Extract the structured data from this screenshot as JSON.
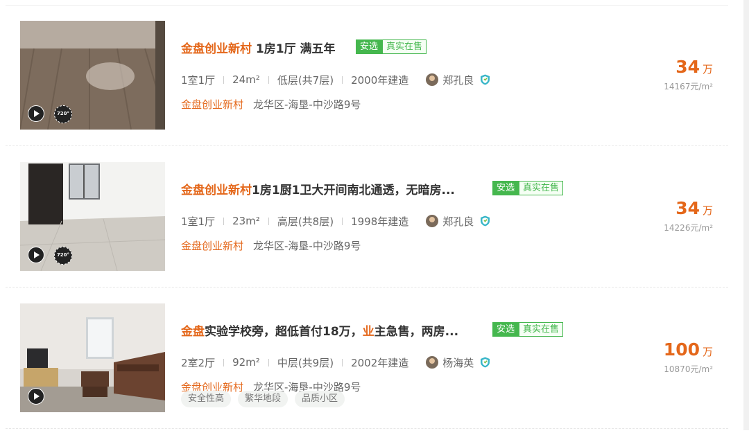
{
  "listings": [
    {
      "title_prefix": "金盘创业新村",
      "title_rest": " 1房1厅 满五年",
      "badge_selected": "安选",
      "badge_real": "真实在售",
      "layout": "1室1厅",
      "area": "24m²",
      "floor": "低层(共7层)",
      "built": "2000年建造",
      "agent": "郑孔良",
      "community": "金盘创业新村",
      "district": "龙华区-海垦-中沙路9号",
      "price": "34",
      "price_unit": "万",
      "unit_price": "14167元/m²",
      "icons": [
        "play-icon",
        "vr-720-icon",
        "verified-shield-icon"
      ]
    },
    {
      "title_prefix": "金盘创业新村",
      "title_rest": "1房1厨1卫大开间南北通透，无暗房...",
      "badge_selected": "安选",
      "badge_real": "真实在售",
      "layout": "1室1厅",
      "area": "23m²",
      "floor": "高层(共8层)",
      "built": "1998年建造",
      "agent": "郑孔良",
      "community": "金盘创业新村",
      "district": "龙华区-海垦-中沙路9号",
      "price": "34",
      "price_unit": "万",
      "unit_price": "14226元/m²",
      "icons": [
        "play-icon",
        "vr-720-icon",
        "verified-shield-icon"
      ]
    },
    {
      "title_hl1": "金盘",
      "title_part2": "实验学校旁，超低首付18万，",
      "title_hl2": "业",
      "title_part3": "主急售，两房...",
      "badge_selected": "安选",
      "badge_real": "真实在售",
      "layout": "2室2厅",
      "area": "92m²",
      "floor": "中层(共9层)",
      "built": "2002年建造",
      "agent": "杨海英",
      "community": "金盘创业新村",
      "district": "龙华区-海垦-中沙路9号",
      "tags": [
        "安全性高",
        "繁华地段",
        "品质小区"
      ],
      "price": "100",
      "price_unit": "万",
      "unit_price": "10870元/m²",
      "icons": [
        "play-icon",
        "verified-shield-icon"
      ]
    }
  ],
  "vr_label": "720°",
  "colors": {
    "accent": "#e4671a",
    "badge_green": "#45b74e",
    "muted": "#999999"
  }
}
